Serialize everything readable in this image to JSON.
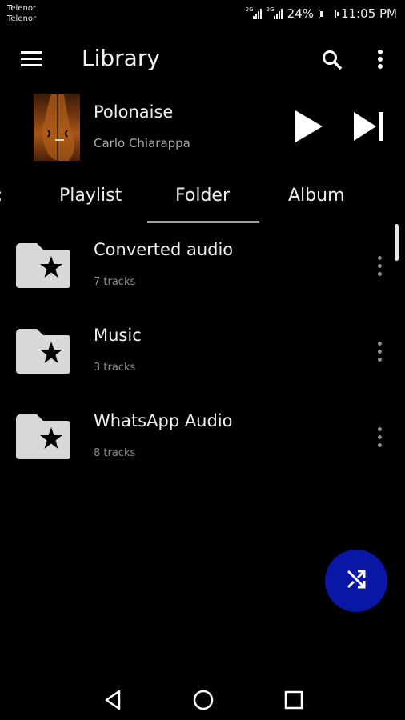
{
  "status_bar": {
    "carrier_1": "Telenor",
    "carrier_2": "Telenor",
    "network_1": "2G",
    "network_2": "2G",
    "battery_percent": "24%",
    "battery_level": 0.24,
    "time": "11:05 PM"
  },
  "app_bar": {
    "title": "Library",
    "icons": [
      "hamburger-menu-icon",
      "search-icon",
      "more-vert-icon"
    ]
  },
  "now_playing": {
    "title": "Polonaise",
    "artist": "Carlo Chiarappa",
    "icons": [
      "play-icon",
      "skip-next-icon"
    ]
  },
  "tabs": {
    "items": [
      {
        "label": "Playlist",
        "selected": false
      },
      {
        "label": "Folder",
        "selected": true
      },
      {
        "label": "Album",
        "selected": false
      }
    ]
  },
  "folders": [
    {
      "name": "Converted audio",
      "count": "7 tracks"
    },
    {
      "name": "Music",
      "count": "3 tracks"
    },
    {
      "name": "WhatsApp Audio",
      "count": "8 tracks"
    }
  ],
  "fab": {
    "icon": "shuffle-icon",
    "color": "#0a17a5"
  },
  "nav_bar": {
    "icons": [
      "back-icon",
      "home-icon",
      "recents-icon"
    ]
  }
}
